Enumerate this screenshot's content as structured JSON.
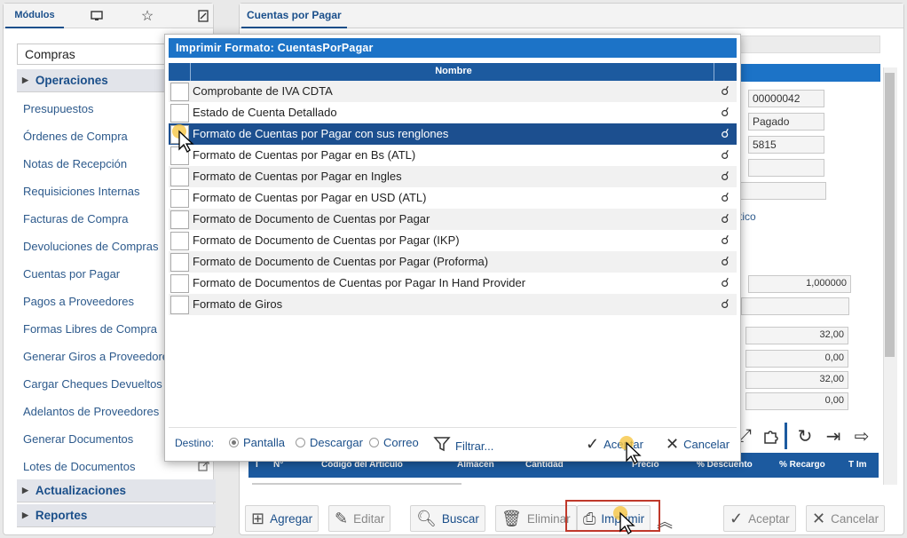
{
  "left_panel": {
    "tabs": {
      "modulos": "Módulos",
      "desktop_icon": "desktop-icon",
      "star_icon": "star-icon",
      "report_icon": "report-icon"
    },
    "module_select": "Compras",
    "sections": {
      "operaciones": "Operaciones",
      "actualizaciones": "Actualizaciones",
      "reportes": "Reportes"
    },
    "items": [
      "Presupuestos",
      "Órdenes de Compra",
      "Notas de Recepción",
      "Requisiciones Internas",
      "Facturas de Compra",
      "Devoluciones de Compras",
      "Cuentas por Pagar",
      "Pagos a Proveedores",
      "Formas Libres de Compra",
      "Generar Giros a Proveedores",
      "Cargar Cheques Devueltos",
      "Adelantos de Proveedores",
      "Generar Documentos",
      "Lotes de Documentos"
    ]
  },
  "right_panel": {
    "tab": "Cuentas por Pagar",
    "fields": {
      "numero": "00000042",
      "estado": "Pagado",
      "codigo": "5815",
      "blank1": "",
      "blank2": "",
      "link_fragment": "tico",
      "tasa": "1,000000",
      "blank3": "",
      "monto1": "32,00",
      "monto2": "0,00",
      "monto3": "32,00",
      "monto4": "0,00"
    },
    "grid_header": [
      "I",
      "N°",
      "Código del Artículo",
      "Almacén",
      "Cantidad",
      "Precio",
      "% Descuento",
      "% Recargo",
      "T Im"
    ],
    "bottom_buttons": {
      "agregar": "Agregar",
      "editar": "Editar",
      "buscar": "Buscar",
      "eliminar": "Eliminar",
      "imprimir": "Imprimir",
      "aceptar": "Aceptar",
      "cancelar": "Cancelar"
    }
  },
  "modal": {
    "title": "Imprimir Formato: CuentasPorPagar",
    "column_header": "Nombre",
    "rows": [
      "Comprobante de IVA CDTA",
      "Estado de Cuenta Detallado",
      "Formato de Cuentas por Pagar con sus renglones",
      "Formato de Cuentas por Pagar en Bs (ATL)",
      "Formato de Cuentas por Pagar en Ingles",
      "Formato de Cuentas por Pagar en USD (ATL)",
      "Formato de Documento de Cuentas por Pagar",
      "Formato de Documento de Cuentas por Pagar (IKP)",
      "Formato de Documento de Cuentas por Pagar (Proforma)",
      "Formato de Documentos de Cuentas por Pagar In Hand Provider",
      "Formato de Giros"
    ],
    "selected_row": 2,
    "footer": {
      "destino_label": "Destino:",
      "pantalla": "Pantalla",
      "descargar": "Descargar",
      "correo": "Correo",
      "selected_destino": "Pantalla",
      "filtrar": "Filtrar...",
      "aceptar": "Aceptar",
      "cancelar": "Cancelar"
    }
  },
  "colors": {
    "primary": "#1c5a9f",
    "title_bar": "#1c73c7",
    "link": "#2d5a8c",
    "highlight_border": "#c0392b"
  }
}
